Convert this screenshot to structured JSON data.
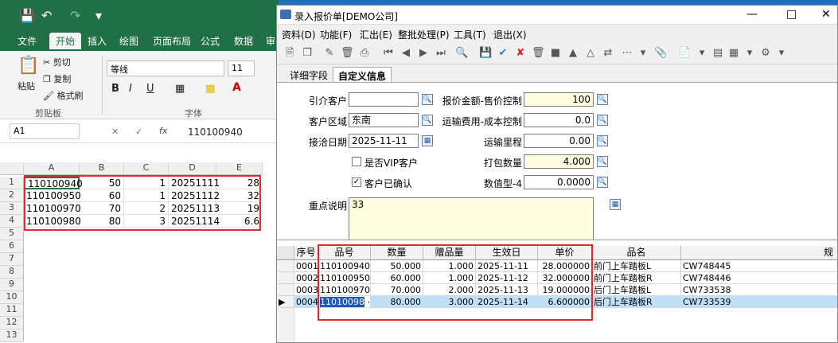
{
  "excel": {
    "tabs": [
      "文件",
      "开始",
      "插入",
      "绘图",
      "页面布局",
      "公式",
      "数据",
      "审"
    ],
    "ribbon": {
      "paste": "粘贴",
      "cut": "剪切",
      "copy": "复制",
      "format_painter": "格式刷",
      "clipboard_group": "剪贴板",
      "font_name": "等线",
      "font_size": "11",
      "font_group": "字体",
      "bold": "B",
      "italic": "I",
      "underline": "U"
    },
    "name_box": "A1",
    "formula": "110100940",
    "fx": "fx",
    "columns": [
      "A",
      "B",
      "C",
      "D",
      "E"
    ],
    "rows": [
      {
        "n": "1",
        "a": "110100940",
        "b": "50",
        "c": "1",
        "d": "20251111",
        "e": "28"
      },
      {
        "n": "2",
        "a": "110100950",
        "b": "60",
        "c": "1",
        "d": "20251112",
        "e": "32"
      },
      {
        "n": "3",
        "a": "110100970",
        "b": "70",
        "c": "2",
        "d": "20251113",
        "e": "19"
      },
      {
        "n": "4",
        "a": "110100980",
        "b": "80",
        "c": "3",
        "d": "20251114",
        "e": "6.6"
      }
    ],
    "empty_rows": [
      "5",
      "6",
      "7",
      "8",
      "9",
      "10",
      "11",
      "12",
      "13"
    ]
  },
  "erp": {
    "title": "录入报价单[DEMO公司]",
    "menu": [
      "资料(D)",
      "功能(F)",
      "汇出(E)",
      "整批处理(P)",
      "工具(T)",
      "退出(X)"
    ],
    "tabs": [
      "详细字段",
      "自定义信息"
    ],
    "form": {
      "referral_label": "引介客户",
      "referral_value": "",
      "region_label": "客户区域",
      "region_value": "东南",
      "contact_date_label": "接洽日期",
      "contact_date_value": "2025-11-11",
      "vip_label": "是否VIP客户",
      "confirmed_label": "客户已确认",
      "notes_label": "重点说明",
      "notes_value": "33",
      "quote_label": "报价金额-售价控制",
      "quote_value": "100",
      "freight_label": "运输费用-成本控制",
      "freight_value": "0.0",
      "mileage_label": "运输里程",
      "mileage_value": "0.00",
      "pack_label": "打包数量",
      "pack_value": "4.000",
      "num4_label": "数值型-4",
      "num4_value": "0.0000"
    },
    "grid": {
      "headers": [
        "序号",
        "品号",
        "数量",
        "赠品量",
        "生效日",
        "单价",
        "品名",
        "规"
      ],
      "rows": [
        {
          "seq": "0001",
          "item": "110100940",
          "qty": "50.000",
          "gift": "1.000",
          "date": "2025-11-11",
          "price": "28.000000",
          "name": "前门上车踏板L",
          "code": "CW748445"
        },
        {
          "seq": "0002",
          "item": "110100950",
          "qty": "60.000",
          "gift": "1.000",
          "date": "2025-11-12",
          "price": "32.000000",
          "name": "前门上车踏板R",
          "code": "CW748446"
        },
        {
          "seq": "0003",
          "item": "110100970",
          "qty": "70.000",
          "gift": "2.000",
          "date": "2025-11-13",
          "price": "19.000000",
          "name": "后门上车踏板L",
          "code": "CW733538"
        },
        {
          "seq": "0004",
          "item": "11010098",
          "qty": "80.000",
          "gift": "3.000",
          "date": "2025-11-14",
          "price": "6.600000",
          "name": "后门上车踏板R",
          "code": "CW733539"
        }
      ]
    }
  },
  "colors": {
    "excel_green": "#1f7145",
    "highlight_red": "#e0282e",
    "selected_row": "#bfe0f6",
    "yellow_field": "#ffffe0"
  }
}
